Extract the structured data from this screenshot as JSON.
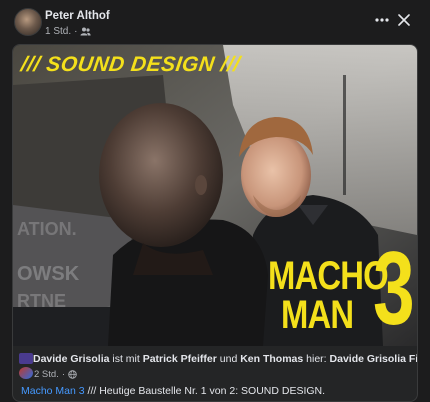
{
  "header": {
    "author": "Peter Althof",
    "time": "1 Std.",
    "separator": "·"
  },
  "icons": {
    "audience": "friends-icon",
    "more": "more-horizontal-icon",
    "close": "close-icon",
    "globe": "globe-icon"
  },
  "image": {
    "banner": "/// SOUND DESIGN ///",
    "title_line1": "MACHO",
    "title_line2": "MAN",
    "title_number": "3",
    "accent_color": "#f4e01b"
  },
  "shared_post": {
    "page_name": "Davide Grisolia",
    "with_text": "ist mit",
    "tag1": "Patrick Pfeiffer",
    "and_text": "und",
    "tag2": "Ken Thomas",
    "here_text": "hier:",
    "location": "Davide Grisolia Films HQ",
    "period": ".",
    "time": "2 Std.",
    "separator": "·",
    "caption_link": "Macho Man 3",
    "caption_text": " /// Heutige Baustelle Nr. 1 von 2: SOUND DESIGN."
  }
}
